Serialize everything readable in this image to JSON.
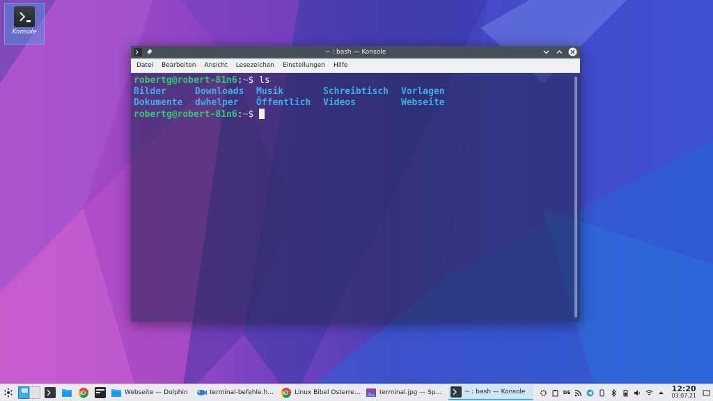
{
  "desktop": {
    "icon_label": "Konsole"
  },
  "window": {
    "title": "~ : bash — Konsole",
    "menu": [
      "Datei",
      "Bearbeiten",
      "Ansicht",
      "Lesezeichen",
      "Einstellungen",
      "Hilfe"
    ]
  },
  "terminal": {
    "prompt": "robertg@robert-81n6",
    "path": "~",
    "prompt_suffix": "$",
    "command": " ls",
    "colon": ":",
    "ls_output": [
      [
        "Bilder",
        "Downloads",
        "Musik",
        "Schreibtisch",
        "Vorlagen"
      ],
      [
        "Dokumente",
        "dwhelper",
        "Öffentlich",
        "Videos",
        "Webseite"
      ]
    ]
  },
  "taskbar": {
    "tasks": [
      {
        "label": "Webseite — Dolphin",
        "icon": "folder-icon"
      },
      {
        "label": "terminal-befehle.htm...",
        "icon": "bluefish-icon"
      },
      {
        "label": "Linux Bibel Österreic...",
        "icon": "chrome-icon"
      },
      {
        "label": "terminal.jpg — Spect...",
        "icon": "image-icon"
      },
      {
        "label": "~ : bash — Konsole",
        "icon": "konsole-icon"
      }
    ],
    "tray_lang": "DE",
    "clock_time": "12:20",
    "clock_date": "03.07.21"
  },
  "colors": {
    "accent": "#3daee9",
    "prompt_green": "#2ecc71",
    "titlebar": "#475057"
  }
}
